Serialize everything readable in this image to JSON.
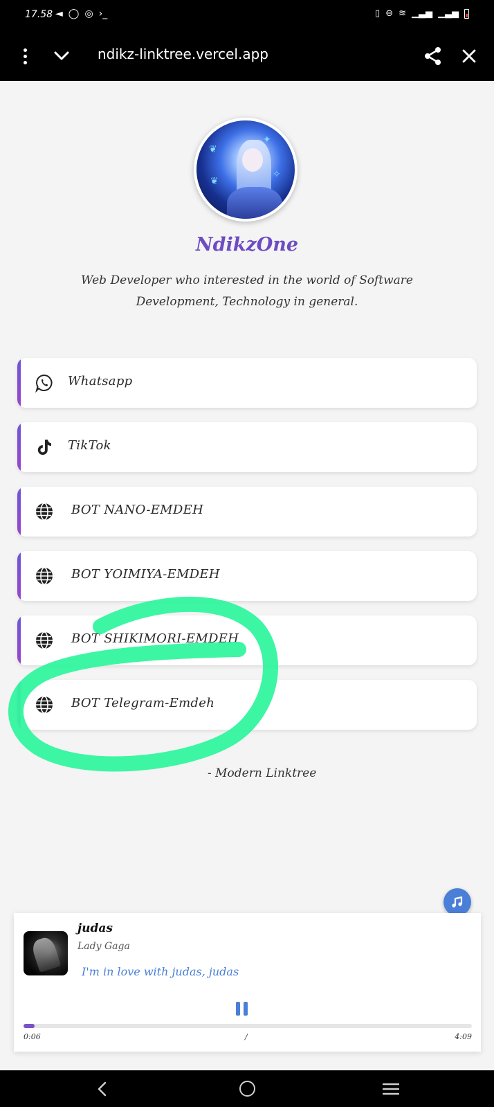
{
  "status_bar": {
    "time": "17.58",
    "left_icons": [
      "telegram-icon",
      "whatsapp-icon",
      "alarm-icon",
      "terminal-icon"
    ],
    "right_icons": [
      "vibrate-icon",
      "dnd-icon",
      "wifi-icon",
      "signal-icon",
      "signal-icon",
      "battery-icon"
    ]
  },
  "browser": {
    "url": "ndikz-linktree.vercel.app"
  },
  "profile": {
    "name": "NdikzOne",
    "bio": "Web Developer who interested in the world of Software Development, Technology in general."
  },
  "links": [
    {
      "label": "Whatsapp",
      "icon": "whatsapp-icon"
    },
    {
      "label": "TikTok",
      "icon": "tiktok-icon"
    },
    {
      "label": "BOT NANO-EMDEH",
      "icon": "globe-icon"
    },
    {
      "label": "BOT YOIMIYA-EMDEH",
      "icon": "globe-icon"
    },
    {
      "label": "BOT SHIKIMORI-EMDEH",
      "icon": "globe-icon"
    },
    {
      "label": "BOT Telegram-Emdeh",
      "icon": "globe-icon"
    }
  ],
  "footer": {
    "text": "- Modern Linktree"
  },
  "player": {
    "title": "judas",
    "artist": "Lady Gaga",
    "lyric": "I'm in love with judas, judas",
    "current_time": "0:06",
    "separator": "/",
    "total_time": "4:09",
    "progress_fraction": 0.025
  },
  "colors": {
    "accent": "#6d4cc2",
    "player_accent": "#4a7fd8",
    "annotation": "#33f59f"
  }
}
